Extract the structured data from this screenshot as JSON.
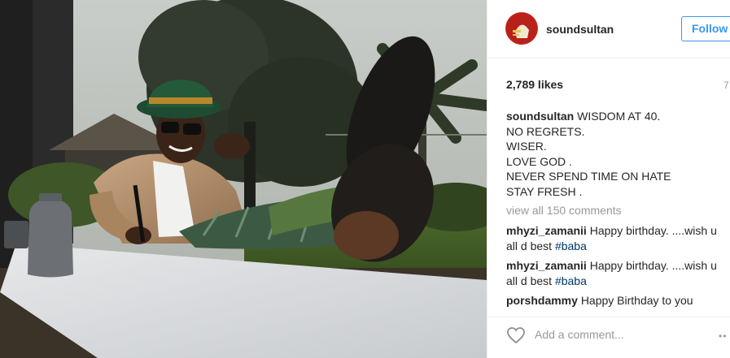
{
  "post": {
    "username": "soundsultan",
    "follow_label": "Follow",
    "likes": "2,789 likes",
    "time_fragment": "7",
    "caption_author": "soundsultan",
    "caption_lines": [
      "WISDOM AT 40.",
      "NO REGRETS.",
      "WISER.",
      "LOVE GOD .",
      "NEVER SPEND TIME ON HATE",
      "STAY FRESH ."
    ],
    "view_all": "view all 150 comments",
    "comments": [
      {
        "author": "mhyzi_zamanii",
        "text": "Happy birthday. ....wish u all d best",
        "tag": "#baba"
      },
      {
        "author": "mhyzi_zamanii",
        "text": "Happy birthday. ....wish u all d best",
        "tag": "#baba"
      },
      {
        "author": "porshdammy",
        "text": "Happy Birthday to you",
        "tag": ""
      }
    ],
    "add_comment_placeholder": "Add a comment...",
    "more_symbol": "••"
  },
  "icons": {
    "avatar": "profile-avatar",
    "heart": "heart-icon",
    "more": "more-options-icon"
  },
  "colors": {
    "link_blue": "#3897f0",
    "hashtag": "#003569",
    "muted": "#999999",
    "text": "#262626"
  }
}
